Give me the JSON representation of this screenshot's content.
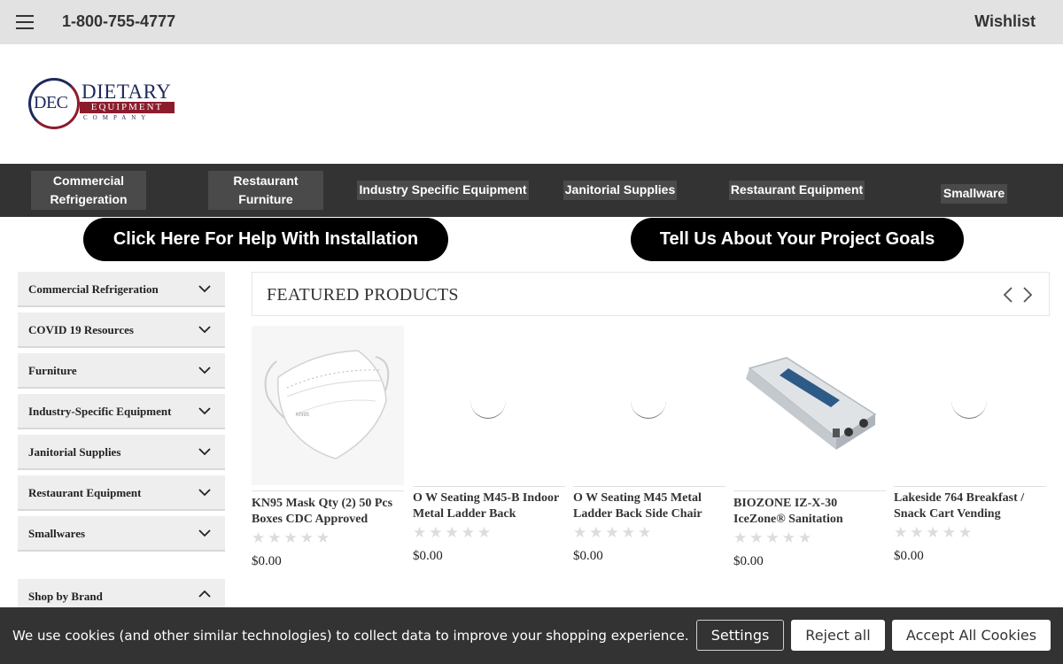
{
  "topbar": {
    "menu_icon": "hamburger-menu-icon",
    "phone": "1-800-755-4777",
    "wishlist": "Wishlist"
  },
  "logo": {
    "initials": "DEC",
    "word1": "DIETARY",
    "word2": "EQUIPMENT",
    "word3": "COMPANY"
  },
  "nav": {
    "items": [
      {
        "label": "Commercial Refrigeration"
      },
      {
        "label": "Restaurant Furniture"
      },
      {
        "label": "Industry Specific Equipment"
      },
      {
        "label": "Janitorial Supplies"
      },
      {
        "label": "Restaurant Equipment"
      },
      {
        "label": "Smallware"
      }
    ]
  },
  "cta": {
    "install": "Click Here For Help With Installation",
    "goals": "Tell Us About Your Project Goals"
  },
  "sidebar": {
    "items": [
      {
        "label": "Commercial Refrigeration"
      },
      {
        "label": "COVID 19 Resources"
      },
      {
        "label": "Furniture"
      },
      {
        "label": "Industry-Specific Equipment"
      },
      {
        "label": "Janitorial Supplies"
      },
      {
        "label": "Restaurant Equipment"
      },
      {
        "label": "Smallwares"
      }
    ],
    "brand": {
      "label": "Shop by Brand"
    }
  },
  "featured": {
    "title": "FEATURED PRODUCTS",
    "prev_icon": "chevron-left-icon",
    "next_icon": "chevron-right-icon",
    "products": [
      {
        "title": "KN95 Mask Qty (2) 50 Pcs Boxes CDC Approved",
        "price": "$0.00",
        "rating": 0,
        "image": "kn95-mask"
      },
      {
        "title": "O W Seating M45-B Indoor Metal Ladder Back",
        "price": "$0.00",
        "rating": 0,
        "image": "loading"
      },
      {
        "title": "O W Seating M45 Metal Ladder Back Side Chair",
        "price": "$0.00",
        "rating": 0,
        "image": "loading"
      },
      {
        "title": "BIOZONE IZ-X-30 IceZone® Sanitation",
        "price": "$0.00",
        "rating": 0,
        "image": "biozone-unit"
      },
      {
        "title": "Lakeside 764 Breakfast / Snack Cart Vending",
        "price": "$0.00",
        "rating": 0,
        "image": "loading"
      }
    ]
  },
  "cookie": {
    "message": "We use cookies (and other similar technologies) to collect data to improve your shopping experience.",
    "settings": "Settings",
    "reject": "Reject all",
    "accept": "Accept All Cookies"
  }
}
